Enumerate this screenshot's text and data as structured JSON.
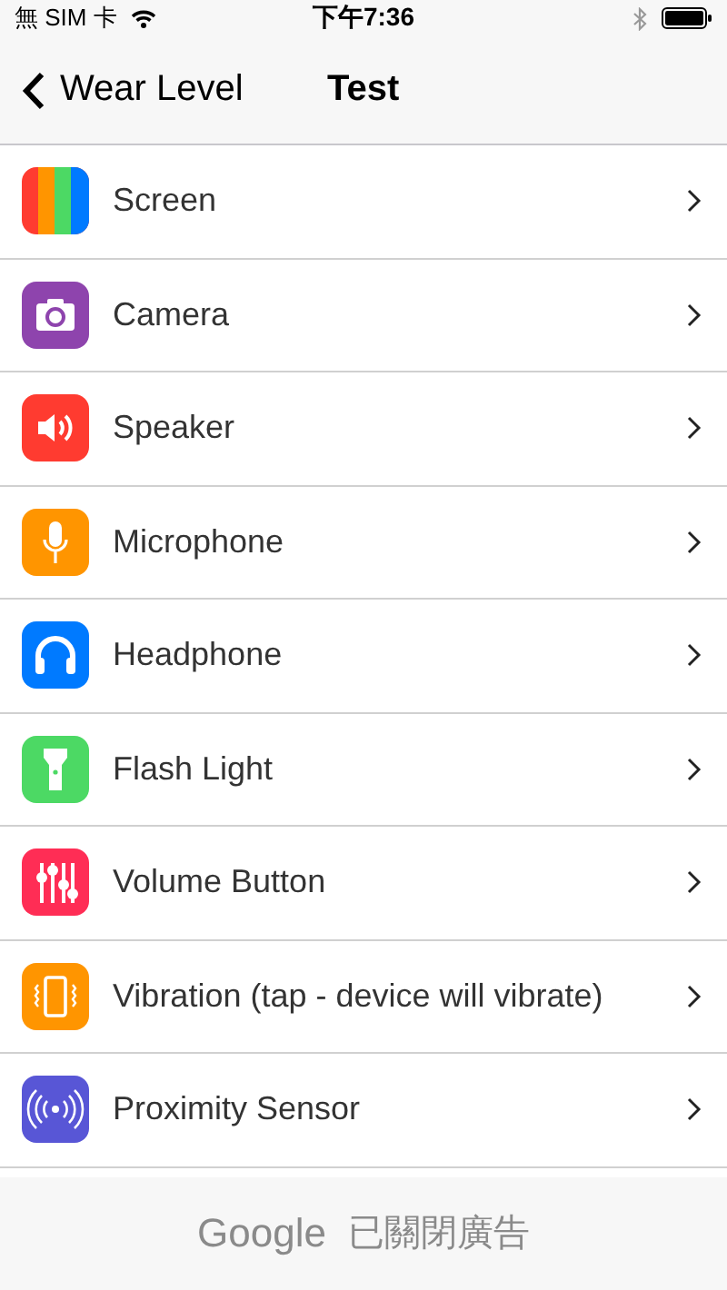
{
  "status_bar": {
    "carrier": "無 SIM 卡",
    "time": "下午7:36"
  },
  "nav": {
    "back": "Wear Level",
    "title": "Test"
  },
  "items": [
    {
      "label": "Screen",
      "kind": "screen",
      "color": "#ff3b30"
    },
    {
      "label": "Camera",
      "kind": "camera",
      "color": "#8e44ad"
    },
    {
      "label": "Speaker",
      "kind": "speaker",
      "color": "#ff3b30"
    },
    {
      "label": "Microphone",
      "kind": "microphone",
      "color": "#ff9500"
    },
    {
      "label": "Headphone",
      "kind": "headphone",
      "color": "#007aff"
    },
    {
      "label": "Flash Light",
      "kind": "flashlight",
      "color": "#4cd964"
    },
    {
      "label": "Volume Button",
      "kind": "sliders",
      "color": "#ff2d55"
    },
    {
      "label": "Vibration (tap - device will vibrate)",
      "kind": "vibration",
      "color": "#ff9500"
    },
    {
      "label": "Proximity Sensor",
      "kind": "proximity",
      "color": "#5856d6"
    }
  ],
  "ad": {
    "brand": "Google",
    "text": "已關閉廣告"
  }
}
